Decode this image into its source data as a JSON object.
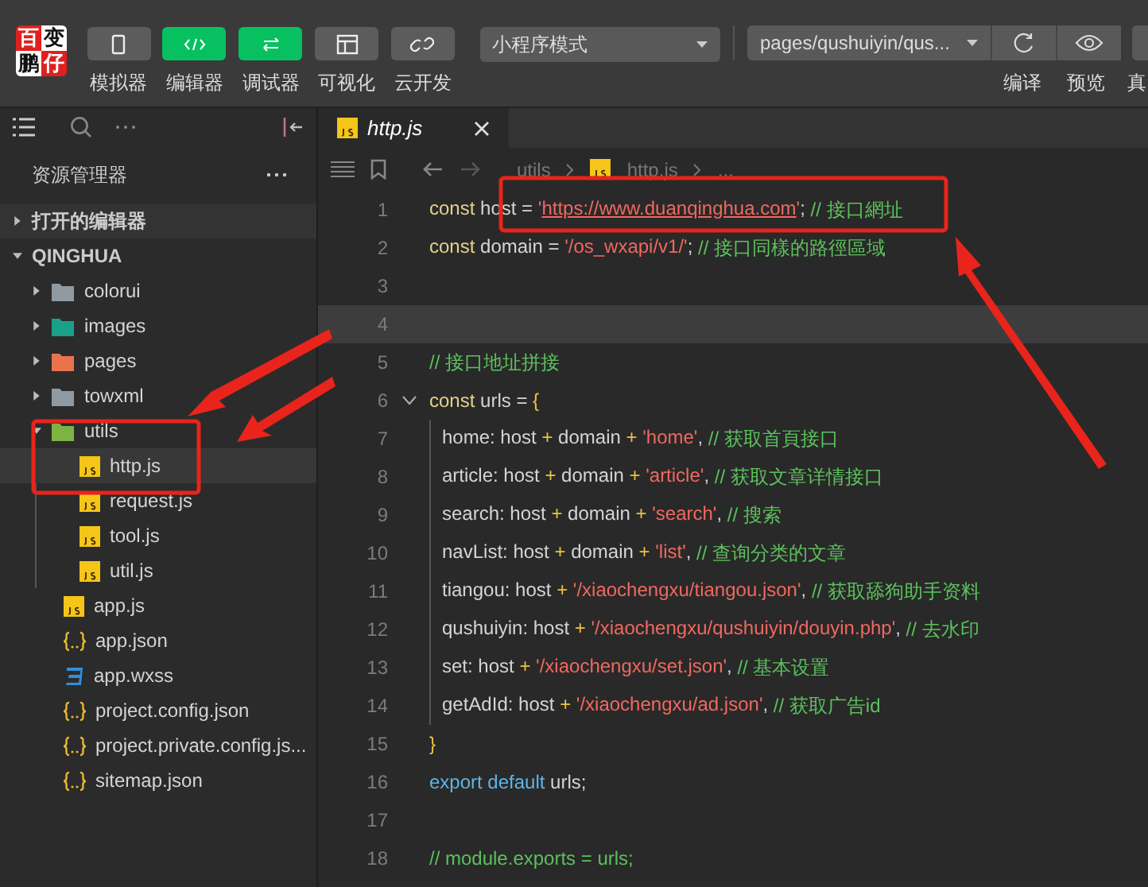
{
  "toolbar": {
    "logo_chars": [
      "百",
      "变",
      "鹏",
      "仔"
    ],
    "modes": [
      {
        "label": "模拟器",
        "selected": false
      },
      {
        "label": "编辑器",
        "selected": true
      },
      {
        "label": "调试器",
        "selected": true
      },
      {
        "label": "可视化",
        "selected": false
      },
      {
        "label": "云开发",
        "selected": false
      }
    ],
    "mode_select": {
      "value": "小程序模式"
    },
    "page_select": {
      "value": "pages/qushuiyin/qus..."
    },
    "actions": [
      {
        "label": "编译"
      },
      {
        "label": "预览"
      },
      {
        "label": "真"
      }
    ]
  },
  "explorer": {
    "title": "资源管理器",
    "sections": [
      {
        "label": "打开的编辑器",
        "expanded": false
      },
      {
        "label": "QINGHUA",
        "expanded": true,
        "children": [
          {
            "name": "colorui",
            "kind": "folder",
            "color": "#8f9aa3",
            "expanded": false,
            "selected": false
          },
          {
            "name": "images",
            "kind": "folder",
            "color": "#1aa08a",
            "expanded": false,
            "selected": false
          },
          {
            "name": "pages",
            "kind": "folder",
            "color": "#e8734d",
            "expanded": false,
            "selected": false
          },
          {
            "name": "towxml",
            "kind": "folder",
            "color": "#8f9aa3",
            "expanded": false,
            "selected": false
          },
          {
            "name": "utils",
            "kind": "folder",
            "color": "#7cb342",
            "expanded": true,
            "selected": false,
            "children": [
              {
                "name": "http.js",
                "kind": "js",
                "selected": true
              },
              {
                "name": "request.js",
                "kind": "js",
                "selected": false
              },
              {
                "name": "tool.js",
                "kind": "js",
                "selected": false
              },
              {
                "name": "util.js",
                "kind": "js",
                "selected": false
              }
            ]
          },
          {
            "name": "app.js",
            "kind": "js",
            "selected": false
          },
          {
            "name": "app.json",
            "kind": "json",
            "selected": false
          },
          {
            "name": "app.wxss",
            "kind": "css",
            "selected": false
          },
          {
            "name": "project.config.json",
            "kind": "json",
            "selected": false
          },
          {
            "name": "project.private.config.js...",
            "kind": "json",
            "selected": false
          },
          {
            "name": "sitemap.json",
            "kind": "json",
            "selected": false
          }
        ]
      }
    ]
  },
  "editor": {
    "tabs": [
      {
        "label": "http.js",
        "selected": true
      }
    ],
    "breadcrumb": [
      "utils",
      "http.js",
      "..."
    ],
    "lines": [
      {
        "number": "1",
        "fold": false,
        "indented": false,
        "highlighted": false,
        "tokens": [
          {
            "kind": "keyword",
            "text": "const"
          },
          {
            "kind": "plain",
            "text": " host = "
          },
          {
            "kind": "string",
            "text": "'"
          },
          {
            "kind": "link",
            "text": "https://www.duanqinghua.com"
          },
          {
            "kind": "string",
            "text": "'"
          },
          {
            "kind": "plain",
            "text": "; "
          },
          {
            "kind": "comment",
            "text": "// 接口網址"
          }
        ]
      },
      {
        "number": "2",
        "fold": false,
        "indented": false,
        "highlighted": false,
        "tokens": [
          {
            "kind": "keyword",
            "text": "const"
          },
          {
            "kind": "plain",
            "text": " domain = "
          },
          {
            "kind": "string",
            "text": "'/os_wxapi/v1/'"
          },
          {
            "kind": "plain",
            "text": "; "
          },
          {
            "kind": "comment",
            "text": "// 接口同樣的路徑區域"
          }
        ]
      },
      {
        "number": "3",
        "fold": false,
        "indented": false,
        "highlighted": false
      },
      {
        "number": "4",
        "fold": false,
        "indented": false,
        "highlighted": true
      },
      {
        "number": "5",
        "fold": false,
        "indented": false,
        "highlighted": false,
        "tokens": [
          {
            "kind": "comment",
            "text": "// 接口地址拼接"
          }
        ]
      },
      {
        "number": "6",
        "fold": true,
        "indented": false,
        "highlighted": false,
        "tokens": [
          {
            "kind": "keyword",
            "text": "const"
          },
          {
            "kind": "plain",
            "text": " urls = "
          },
          {
            "kind": "operator",
            "text": "{"
          }
        ]
      },
      {
        "number": "7",
        "fold": false,
        "indented": true,
        "highlighted": false,
        "tokens": [
          {
            "kind": "plain",
            "text": "home: host "
          },
          {
            "kind": "operator",
            "text": "+"
          },
          {
            "kind": "plain",
            "text": " domain "
          },
          {
            "kind": "operator",
            "text": "+"
          },
          {
            "kind": "string",
            "text": " 'home'"
          },
          {
            "kind": "plain",
            "text": ", "
          },
          {
            "kind": "comment",
            "text": "// 获取首頁接口"
          }
        ]
      },
      {
        "number": "8",
        "fold": false,
        "indented": true,
        "highlighted": false,
        "tokens": [
          {
            "kind": "plain",
            "text": "article: host "
          },
          {
            "kind": "operator",
            "text": "+"
          },
          {
            "kind": "plain",
            "text": " domain "
          },
          {
            "kind": "operator",
            "text": "+"
          },
          {
            "kind": "string",
            "text": " 'article'"
          },
          {
            "kind": "plain",
            "text": ", "
          },
          {
            "kind": "comment",
            "text": "// 获取文章详情接口"
          }
        ]
      },
      {
        "number": "9",
        "fold": false,
        "indented": true,
        "highlighted": false,
        "tokens": [
          {
            "kind": "plain",
            "text": "search: host "
          },
          {
            "kind": "operator",
            "text": "+"
          },
          {
            "kind": "plain",
            "text": " domain "
          },
          {
            "kind": "operator",
            "text": "+"
          },
          {
            "kind": "string",
            "text": " 'search'"
          },
          {
            "kind": "plain",
            "text": ", "
          },
          {
            "kind": "comment",
            "text": "// 搜索"
          }
        ]
      },
      {
        "number": "10",
        "fold": false,
        "indented": true,
        "highlighted": false,
        "tokens": [
          {
            "kind": "plain",
            "text": "navList: host "
          },
          {
            "kind": "operator",
            "text": "+"
          },
          {
            "kind": "plain",
            "text": " domain "
          },
          {
            "kind": "operator",
            "text": "+"
          },
          {
            "kind": "string",
            "text": " 'list'"
          },
          {
            "kind": "plain",
            "text": ", "
          },
          {
            "kind": "comment",
            "text": "// 查询分类的文章"
          }
        ]
      },
      {
        "number": "11",
        "fold": false,
        "indented": true,
        "highlighted": false,
        "tokens": [
          {
            "kind": "plain",
            "text": "tiangou: host "
          },
          {
            "kind": "operator",
            "text": "+"
          },
          {
            "kind": "string",
            "text": " '/xiaochengxu/tiangou.json'"
          },
          {
            "kind": "plain",
            "text": ", "
          },
          {
            "kind": "comment",
            "text": "// 获取舔狗助手资料"
          }
        ]
      },
      {
        "number": "12",
        "fold": false,
        "indented": true,
        "highlighted": false,
        "tokens": [
          {
            "kind": "plain",
            "text": "qushuiyin: host "
          },
          {
            "kind": "operator",
            "text": "+"
          },
          {
            "kind": "string",
            "text": " '/xiaochengxu/qushuiyin/douyin.php'"
          },
          {
            "kind": "plain",
            "text": ", "
          },
          {
            "kind": "comment",
            "text": "// 去水印"
          }
        ]
      },
      {
        "number": "13",
        "fold": false,
        "indented": true,
        "highlighted": false,
        "tokens": [
          {
            "kind": "plain",
            "text": "set: host "
          },
          {
            "kind": "operator",
            "text": "+"
          },
          {
            "kind": "string",
            "text": " '/xiaochengxu/set.json'"
          },
          {
            "kind": "plain",
            "text": ", "
          },
          {
            "kind": "comment",
            "text": "// 基本设置"
          }
        ]
      },
      {
        "number": "14",
        "fold": false,
        "indented": true,
        "highlighted": false,
        "tokens": [
          {
            "kind": "plain",
            "text": "getAdId: host "
          },
          {
            "kind": "operator",
            "text": "+"
          },
          {
            "kind": "string",
            "text": " '/xiaochengxu/ad.json'"
          },
          {
            "kind": "plain",
            "text": ", "
          },
          {
            "kind": "comment",
            "text": "// 获取广告id"
          }
        ]
      },
      {
        "number": "15",
        "fold": false,
        "indented": false,
        "highlighted": false,
        "tokens": [
          {
            "kind": "operator",
            "text": "}"
          }
        ]
      },
      {
        "number": "16",
        "fold": false,
        "indented": false,
        "highlighted": false,
        "tokens": [
          {
            "kind": "export",
            "text": "export default"
          },
          {
            "kind": "plain",
            "text": " urls;"
          }
        ]
      },
      {
        "number": "17",
        "fold": false,
        "indented": false,
        "highlighted": false
      },
      {
        "number": "18",
        "fold": false,
        "indented": false,
        "highlighted": false,
        "tokens": [
          {
            "kind": "comment",
            "text": "// module.exports = urls;"
          }
        ]
      }
    ]
  }
}
